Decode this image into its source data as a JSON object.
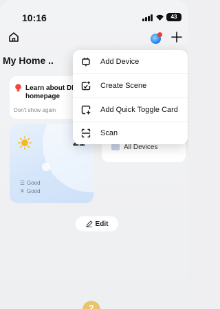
{
  "status_bar": {
    "time": "10:16",
    "battery": "43"
  },
  "header": {
    "title": "My Home .."
  },
  "learn_card": {
    "title": "Learn about DIY homepage",
    "dismiss": "Don't show again"
  },
  "weather": {
    "temperature": "21",
    "air_rows": [
      {
        "icon": "air-quality-icon",
        "label": "Good"
      },
      {
        "icon": "plant-icon",
        "label": "Good"
      }
    ]
  },
  "devices_card": {
    "label": "All Devices"
  },
  "edit_button": {
    "label": "Edit"
  },
  "bottom_badge": {
    "label": "2"
  },
  "menu": {
    "items": [
      {
        "label": "Add Device",
        "icon": "add-device-icon"
      },
      {
        "label": "Create Scene",
        "icon": "create-scene-icon"
      },
      {
        "label": "Add Quick Toggle Card",
        "icon": "add-card-icon"
      },
      {
        "label": "Scan",
        "icon": "scan-icon"
      }
    ]
  },
  "colors": {
    "background": "#efeff1",
    "menu_background": "#ffffff",
    "avatar_dot": "#f23b30",
    "sun": "#f5b921",
    "bulb": "#f0483c"
  }
}
